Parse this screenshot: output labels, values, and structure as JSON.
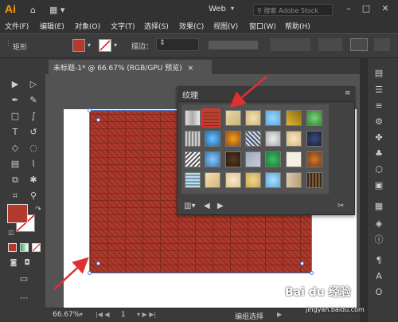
{
  "app": {
    "logo": "Ai",
    "workspace": "Web",
    "search_placeholder": "搜索 Adobe Stock"
  },
  "menu": [
    "文件(F)",
    "编辑(E)",
    "对象(O)",
    "文字(T)",
    "选择(S)",
    "效果(C)",
    "视图(V)",
    "窗口(W)",
    "帮助(H)"
  ],
  "control": {
    "shape_label": "矩形",
    "stroke_label": "描边："
  },
  "doc_tab": {
    "title": "未标题-1* @ 66.67% (RGB/GPU 预览)",
    "close": "×"
  },
  "status": {
    "zoom": "66.67%",
    "page": "1",
    "text": "编组选择"
  },
  "panel": {
    "title": "纹理",
    "menu_icon": "≡"
  },
  "colors": {
    "fill": "#b33a2c",
    "accent_arrow": "#e03030"
  },
  "watermark": {
    "brand": "Bai du 经验",
    "url": "jingyan.baidu.com"
  }
}
